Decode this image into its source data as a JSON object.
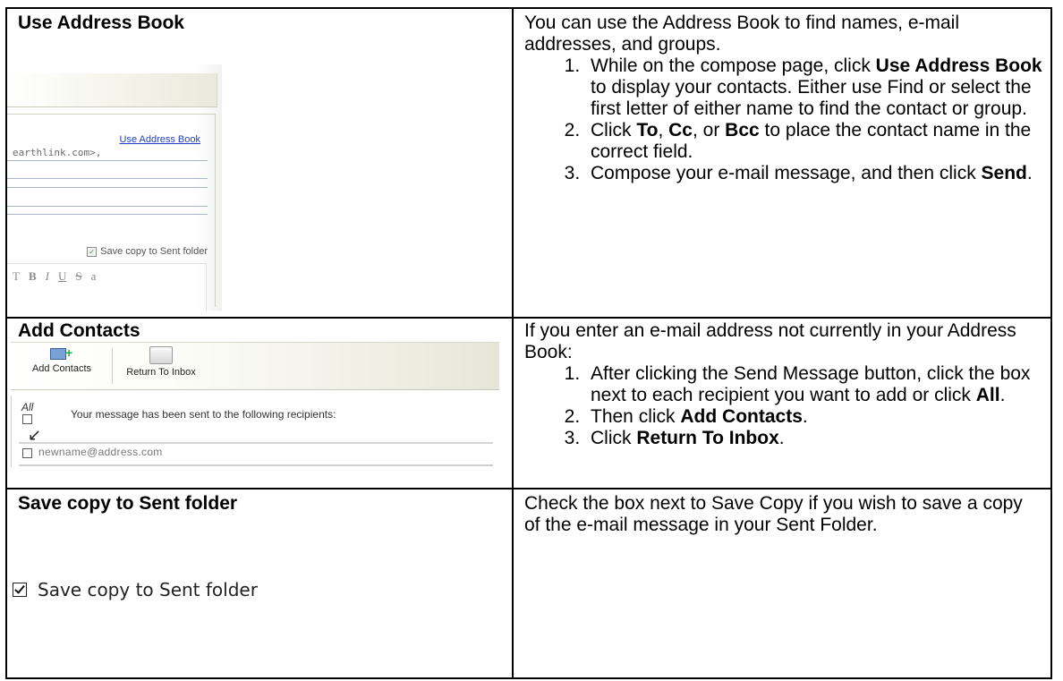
{
  "sections": [
    {
      "heading": "Use Address Book",
      "intro": "You can use the Address Book to find names, e-mail addresses, and groups.",
      "steps": [
        {
          "pre": "While on the compose page, click ",
          "bold": "Use Address Book",
          "post": " to display your contacts. Either use Find or select the first letter of either name to find the contact or group."
        },
        {
          "pre": "Click ",
          "bold1": "To",
          "mid1": ", ",
          "bold2": "Cc",
          "mid2": ", or ",
          "bold3": "Bcc",
          "post": " to place the contact name in the correct field."
        },
        {
          "pre": "Compose your e-mail message, and then click ",
          "bold": "Send",
          "post": "."
        }
      ],
      "screenshot": {
        "link": "Use Address Book",
        "address": "earthlink.com>,",
        "save_label": "Save copy to Sent folder",
        "toolbar_glyphs": [
          "T",
          "B",
          "I",
          "U",
          "S",
          "a"
        ]
      }
    },
    {
      "heading": "Add Contacts",
      "intro": "If you enter an e-mail address not currently in your Address Book:",
      "steps": [
        {
          "pre": "After clicking the Send Message button, click the box next to each recipient you want to add or click ",
          "bold": "All",
          "post": "."
        },
        {
          "pre": "Then click ",
          "bold": "Add Contacts",
          "post": "."
        },
        {
          "pre": "Click ",
          "bold": "Return To Inbox",
          "post": "."
        }
      ],
      "screenshot": {
        "btn_add": "Add Contacts",
        "btn_return": "Return To Inbox",
        "all_label": "All",
        "message": "Your message has been sent to the following recipients:",
        "recipient": "newname@address.com",
        "arrow": "↙"
      }
    },
    {
      "heading": "Save copy to Sent folder",
      "intro": "Check the box next to Save Copy if you wish to save a copy of the e-mail message in your Sent Folder.",
      "screenshot": {
        "label": "Save copy to Sent folder"
      }
    }
  ]
}
